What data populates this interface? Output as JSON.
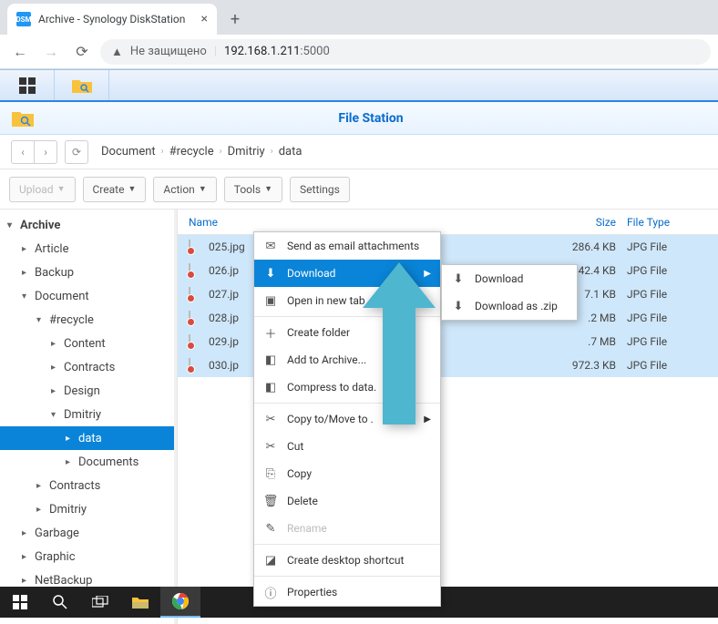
{
  "browser": {
    "tab_title": "Archive - Synology DiskStation",
    "favicon_text": "DSM",
    "address_security": "Не защищено",
    "address_url": "192.168.1.211",
    "address_port": ":5000"
  },
  "fs": {
    "title": "File Station"
  },
  "breadcrumb": [
    "Document",
    "#recycle",
    "Dmitriy",
    "data"
  ],
  "buttons": {
    "upload": "Upload",
    "create": "Create",
    "action": "Action",
    "tools": "Tools",
    "settings": "Settings"
  },
  "tree": [
    {
      "label": "Archive",
      "indent": 8,
      "toggle": "▾",
      "root": true
    },
    {
      "label": "Article",
      "indent": 24,
      "toggle": "▸"
    },
    {
      "label": "Backup",
      "indent": 24,
      "toggle": "▸"
    },
    {
      "label": "Document",
      "indent": 24,
      "toggle": "▾"
    },
    {
      "label": "#recycle",
      "indent": 40,
      "toggle": "▾"
    },
    {
      "label": "Content",
      "indent": 56,
      "toggle": "▸"
    },
    {
      "label": "Contracts",
      "indent": 56,
      "toggle": "▸"
    },
    {
      "label": "Design",
      "indent": 56,
      "toggle": "▸"
    },
    {
      "label": "Dmitriy",
      "indent": 56,
      "toggle": "▾"
    },
    {
      "label": "data",
      "indent": 72,
      "toggle": "▸",
      "active": true
    },
    {
      "label": "Documents",
      "indent": 72,
      "toggle": "▸"
    },
    {
      "label": "Contracts",
      "indent": 40,
      "toggle": "▸"
    },
    {
      "label": "Dmitriy",
      "indent": 40,
      "toggle": "▸"
    },
    {
      "label": "Garbage",
      "indent": 24,
      "toggle": "▸"
    },
    {
      "label": "Graphic",
      "indent": 24,
      "toggle": "▸"
    },
    {
      "label": "NetBackup",
      "indent": 24,
      "toggle": "▸"
    }
  ],
  "columns": {
    "name": "Name",
    "size": "Size",
    "type": "File Type"
  },
  "files": [
    {
      "name": "025.jpg",
      "size": "286.4 KB",
      "type": "JPG File",
      "sel": true
    },
    {
      "name": "026.jp",
      "size": "342.4 KB",
      "type": "JPG File",
      "sel": true
    },
    {
      "name": "027.jp",
      "size": "7.1 KB",
      "type": "JPG File",
      "sel": true
    },
    {
      "name": "028.jp",
      "size": ".2 MB",
      "type": "JPG File",
      "sel": true
    },
    {
      "name": "029.jp",
      "size": ".7 MB",
      "type": "JPG File",
      "sel": true
    },
    {
      "name": "030.jp",
      "size": "972.3 KB",
      "type": "JPG File",
      "sel": true
    }
  ],
  "context_menu": [
    {
      "label": "Send as email attachments",
      "icon": "✉"
    },
    {
      "label": "Download",
      "icon": "⬇",
      "hover": true,
      "submenu": true
    },
    {
      "label": "Open in new tab",
      "icon": "▣"
    },
    {
      "sep": true
    },
    {
      "label": "Create folder",
      "icon": "＋"
    },
    {
      "label": "Add to Archive...",
      "icon": "◧"
    },
    {
      "label": "Compress to data.",
      "icon": "◧"
    },
    {
      "sep": true
    },
    {
      "label": "Copy to/Move to .",
      "icon": "✂",
      "submenu": true
    },
    {
      "label": "Cut",
      "icon": "✂"
    },
    {
      "label": "Copy",
      "icon": "⎘"
    },
    {
      "label": "Delete",
      "icon": "🗑"
    },
    {
      "label": "Rename",
      "icon": "✎",
      "disabled": true
    },
    {
      "sep": true
    },
    {
      "label": "Create desktop shortcut",
      "icon": "◪"
    },
    {
      "sep": true
    },
    {
      "label": "Properties",
      "icon": "ⓘ"
    }
  ],
  "submenu": [
    {
      "label": "Download",
      "icon": "⬇"
    },
    {
      "label": "Download as .zip",
      "icon": "⬇"
    }
  ]
}
